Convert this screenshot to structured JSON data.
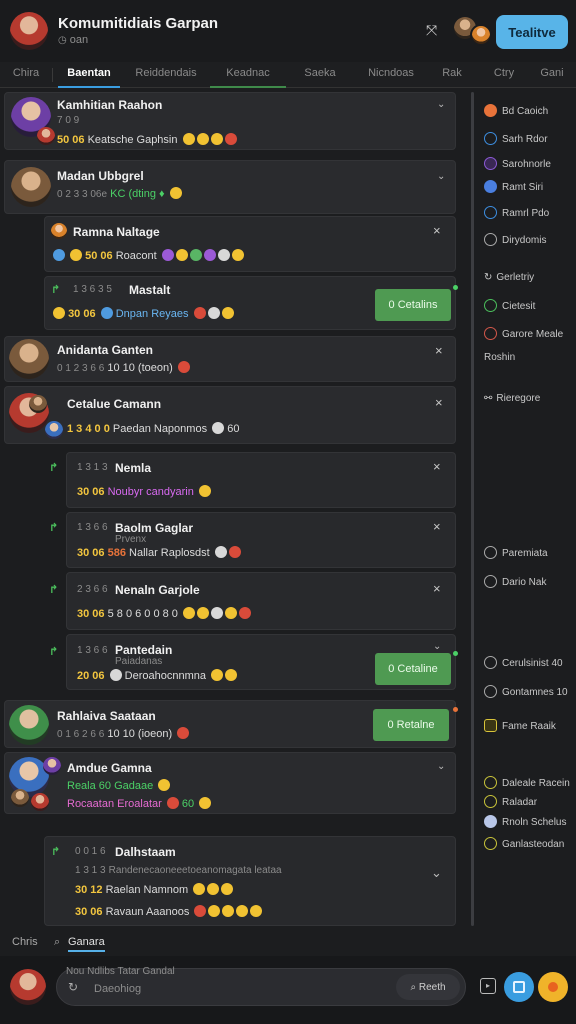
{
  "header": {
    "title": "Komumitidiais Garpan",
    "subtitle": "oan",
    "action_label": "Tealitve"
  },
  "tabs": [
    "Chira",
    "Baentan",
    "Reiddendais",
    "Keadnac",
    "Saeka",
    "Nicndoas",
    "Rak",
    "Ctry",
    "Gani"
  ],
  "feed": {
    "items": [
      {
        "title": "Kamhitian Raahon",
        "meta": "7 0 9",
        "line_num": "50 06",
        "line_text": "Keatsche Gaphsin",
        "chevron": "⌄"
      },
      {
        "title": "Madan Ubbgrel",
        "meta": "0 2 3 3 06e",
        "line_text_green": "KC (dting",
        "line_mid": "♦",
        "chevron": "⌄"
      },
      {
        "title": "Ramna Naltage",
        "line_num": "50 06",
        "line_text": "Roacont",
        "close": "×"
      },
      {
        "time": "1 3 6 3 5",
        "title": "Mastalt",
        "line_num": "30 06",
        "line_text": "Dnpan Reyaes",
        "button": "0 Cetalins"
      },
      {
        "title": "Anidanta Ganten",
        "meta": "0 1 2 3 6 6",
        "line_text": "10 10 (toeon)",
        "close": "×"
      },
      {
        "title": "Cetalue Camann",
        "line_num": "1 3 4 0 0",
        "line_text": "Paedan Naponmos",
        "line_tail": "60",
        "close": "×"
      },
      {
        "time": "1 3 1 3",
        "title": "Nemla",
        "line_num": "30 06",
        "line_text": "Noubyr candyarin",
        "close": "×"
      },
      {
        "time": "1 3 6 6",
        "title": "Baolm Gaglar",
        "sub": "Prvenx",
        "line_num": "30 06",
        "line_pre": "586",
        "line_text": "Nallar Raplosdst",
        "close": "×"
      },
      {
        "time": "2 3 6 6",
        "title": "Nenaln Garjole",
        "line_num": "30 06",
        "line_text": "5 8 0 6 0 0 8 0",
        "close": "×"
      },
      {
        "time": "1 3 6 6",
        "title": "Pantedain",
        "sub": "Paiadanas",
        "line_num": "20 06",
        "line_text": "Deroahocnnmna",
        "chevron": "⌄",
        "button": "0 Cetaline"
      },
      {
        "title": "Rahlaiva Saataan",
        "meta": "0 1 6 2 6 6",
        "line_text": "10 10 (ioeon)",
        "button": "0 Retalne"
      },
      {
        "title": "Amdue Gamna",
        "line_green": "Reala 60 Gadaae",
        "line_pink": "Rocaatan Eroalatar",
        "line_tail": "60",
        "chevron": "⌄"
      },
      {
        "time": "0 0 1 6",
        "title": "Dalhstaam",
        "line2_num": "1 3 1 3",
        "line2_text": "Randenecaoneeetoeanomagata leataa",
        "line3_num": "30 12",
        "line3_text": "Raelan Namnom",
        "line4_num": "30 06",
        "line4_text": "Ravaun Aaanoos",
        "chevron": "⌄"
      }
    ]
  },
  "right_panel": {
    "items": [
      {
        "label": "Bd Caoich",
        "icon": "orange-dot-icon"
      },
      {
        "label": "Sarh Rdor",
        "icon": "blue-ring-icon"
      },
      {
        "label": "Sarohnorle",
        "icon": "purple-gear-icon"
      },
      {
        "label": "Ramt Siri",
        "icon": "blue-dot-icon"
      },
      {
        "label": "Ramrl Pdo",
        "icon": "blue-ring-icon"
      },
      {
        "label": "Dirydomis",
        "icon": "clock-icon"
      },
      {
        "label": "Gerletriy",
        "icon": "arrow-icon"
      },
      {
        "label": "Cietesit",
        "icon": "green-ring-icon"
      },
      {
        "label": "Garore Meale",
        "icon": "red-ring-icon"
      },
      {
        "label": "Roshin",
        "icon": ""
      },
      {
        "label": "Rieregore",
        "icon": "link-icon"
      },
      {
        "label": "Paremiata",
        "icon": "clock-icon"
      },
      {
        "label": "Dario Nak",
        "icon": "clock-icon"
      },
      {
        "label": "Cerulsinist 40",
        "icon": "clock-icon"
      },
      {
        "label": "Gontamnes 10",
        "icon": "clock-icon"
      },
      {
        "label": "Fame Raaik",
        "icon": "yellow-box-icon"
      },
      {
        "label": "Daleale Racein",
        "icon": "yellow-ring-icon"
      },
      {
        "label": "Raladar",
        "icon": "yellow-ring-icon"
      },
      {
        "label": "Rnoln Schelus",
        "icon": "avatar-icon"
      },
      {
        "label": "Ganlasteodan",
        "icon": "yellow-ring-icon"
      }
    ]
  },
  "bottom_tabs": [
    "Chris",
    "Ganara"
  ],
  "composer": {
    "hint": "Nou Ndlibs Tatar Gandal",
    "placeholder": "Daeohiog",
    "send_label": "Reeth"
  },
  "colors": {
    "accent_blue": "#58b4e8",
    "green_button": "#4f9a52",
    "background": "#1c1d1f"
  }
}
